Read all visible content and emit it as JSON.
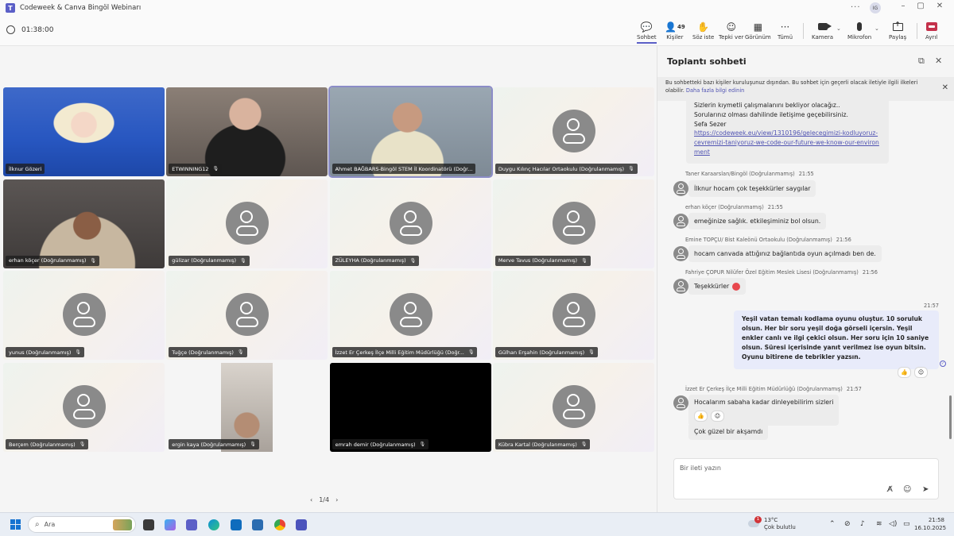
{
  "window": {
    "title": "Codeweek & Canva Bingöl Webinarı",
    "user_initials": "IG"
  },
  "toolbar": {
    "timer": "01:38:00",
    "chat": "Sohbet",
    "people": "Kişiler",
    "people_count": "49",
    "raise": "Söz iste",
    "react": "Tepki ver",
    "view": "Görünüm",
    "more": "Tümü",
    "camera": "Kamera",
    "mic": "Mikrofon",
    "share": "Paylaş",
    "leave": "Ayrıl"
  },
  "participants": [
    {
      "name": "İlknur Gözeri",
      "muted": false
    },
    {
      "name": "ETWINNING12",
      "muted": true
    },
    {
      "name": "Ahmet BAĞBARS-Bingöl STEM İl Koordinatörü (Doğr...",
      "muted": false
    },
    {
      "name": "Duygu Kılınç Hacılar Ortaokulu (Doğrulanmamış)",
      "muted": true
    },
    {
      "name": "erhan köçer (Doğrulanmamış)",
      "muted": true
    },
    {
      "name": "gülizar (Doğrulanmamış)",
      "muted": true
    },
    {
      "name": "ZÜLEYHA (Doğrulanmamış)",
      "muted": true
    },
    {
      "name": "Merve Tavus (Doğrulanmamış)",
      "muted": true
    },
    {
      "name": "yunus (Doğrulanmamış)",
      "muted": true
    },
    {
      "name": "Tuğçe (Doğrulanmamış)",
      "muted": true
    },
    {
      "name": "İzzet Er Çerkeş İlçe Milli Eğitim Müdürlüğü (Doğr...",
      "muted": true
    },
    {
      "name": "Gülhan Erşahin (Doğrulanmamış)",
      "muted": true
    },
    {
      "name": "Berçem (Doğrulanmamış)",
      "muted": true
    },
    {
      "name": "ergin kaya (Doğrulanmamış)",
      "muted": true
    },
    {
      "name": "emrah demir (Doğrulanmamış)",
      "muted": true
    },
    {
      "name": "Kübra Kartal (Doğrulanmamış)",
      "muted": true
    }
  ],
  "pager": {
    "label": "1/4",
    "prev": "‹",
    "next": "›"
  },
  "chat": {
    "title": "Toplantı sohbeti",
    "notice": "Bu sohbetteki bazı kişiler kuruluşunuz dışından. Bu sohbet için geçerli olacak iletiyle ilgili ilkeleri olabilir.",
    "notice_link": "Daha fazla bilgi edinin",
    "first_message": {
      "lines": [
        "Sizlerin kıymetli çalışmalanını bekliyor olacağız..",
        "Sorularınız olması dahilinde iletişime geçebilirsiniz.",
        "Sefa Sezer"
      ],
      "link": "https://codeweek.eu/view/1310196/gelecegimizi-kodluyoruz-cevremizi-taniyoruz-we-code-our-future-we-know-our-environment"
    },
    "messages": [
      {
        "sender": "Taner Karaarslan/Bingöl (Doğrulanmamış)",
        "time": "21:55",
        "text": "İlknur hocam çok teşekkürler saygılar"
      },
      {
        "sender": "erhan köçer (Doğrulanmamış)",
        "time": "21:55",
        "text": "emeğinize sağlık. etkileşiminiz bol olsun."
      },
      {
        "sender": "Emine TOPÇU/ Bist Kaleönü Ortaokulu (Doğrulanmamış)",
        "time": "21:56",
        "text": "hocam canvada attığınız bağlantıda oyun açılmadı ben de."
      },
      {
        "sender": "Fahriye ÇOPUR Nilüfer Özel Eğitim Meslek Lisesi (Doğrulanmamış)",
        "time": "21:56",
        "text": "Teşekkürler"
      }
    ],
    "my_message": {
      "time": "21:57",
      "text": "Yeşil vatan temalı kodlama oyunu oluştur. 10 soruluk olsun. Her bir soru yeşil doğa görseli içersin. Yeşil enkler canlı ve ilgi çekici olsun. Her soru için 10 saniye olsun. Süresi içerisinde yanıt verilmez ise oyun bitsin. Oyunu bitirene de tebrikler yazsın."
    },
    "last": {
      "sender": "İzzet Er Çerkeş İlçe Milli Eğitim Müdürlüğü (Doğrulanmamış)",
      "time": "21:57",
      "text1": "Hocalarım sabaha kadar dinleyebilirim sizleri",
      "text2": "Çok güzel bir akşamdı"
    },
    "compose_placeholder": "Bir ileti yazın"
  },
  "taskbar": {
    "search": "Ara",
    "weather_badge": "1",
    "temp": "13°C",
    "weather": "Çok bulutlu",
    "time": "21:58",
    "date": "16.10.2025"
  }
}
